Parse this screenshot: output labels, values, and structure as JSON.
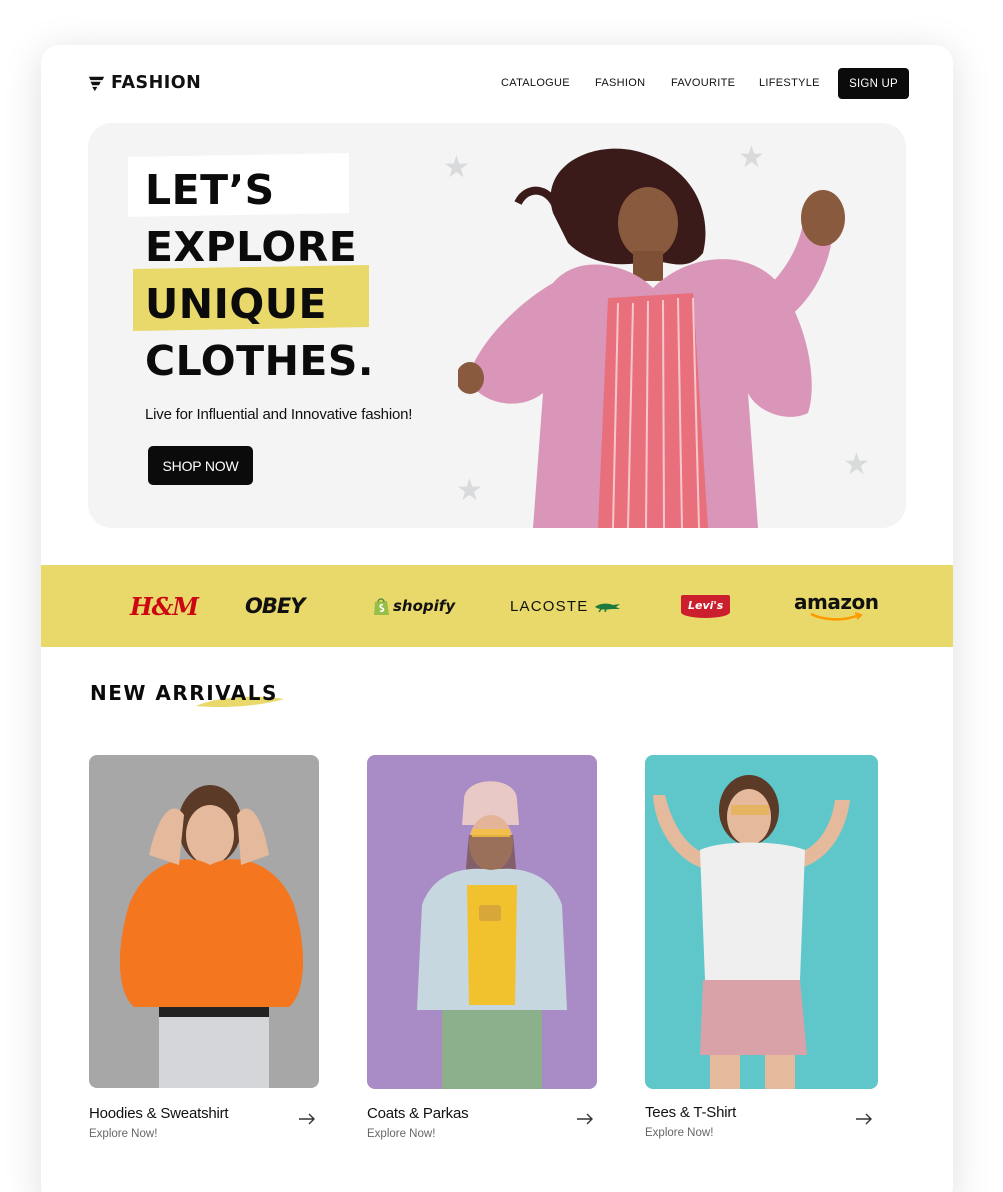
{
  "nav": {
    "logo_text": "FASHION",
    "links": [
      "CATALOGUE",
      "FASHION",
      "FAVOURITE",
      "LIFESTYLE"
    ],
    "signup_label": "SIGN UP"
  },
  "hero": {
    "headline": [
      "LET’S",
      "EXPLORE",
      "UNIQUE",
      "CLOTHES."
    ],
    "subtitle": "Live for Influential and Innovative fashion!",
    "cta_label": "SHOP NOW"
  },
  "brands": [
    "H&M",
    "OBEY",
    "shopify",
    "LACOSTE",
    "Levi's",
    "amazon"
  ],
  "new_arrivals": {
    "title": "NEW ARRIVALS",
    "cards": [
      {
        "title": "Hoodies & Sweatshirt",
        "subtitle": "Explore Now!"
      },
      {
        "title": "Coats & Parkas",
        "subtitle": "Explore Now!"
      },
      {
        "title": "Tees & T-Shirt",
        "subtitle": "Explore Now!"
      }
    ]
  },
  "colors": {
    "accent_yellow": "#e8d96a",
    "black": "#0b0b0b",
    "hero_bg": "#f3f4f3",
    "levis_red": "#cc1f2d",
    "hm_red": "#cc0712"
  },
  "icons": [
    "logo-icon",
    "star-icon",
    "arrow-right-icon",
    "crocodile-icon",
    "shopify-bag-icon",
    "amazon-smile-icon"
  ]
}
